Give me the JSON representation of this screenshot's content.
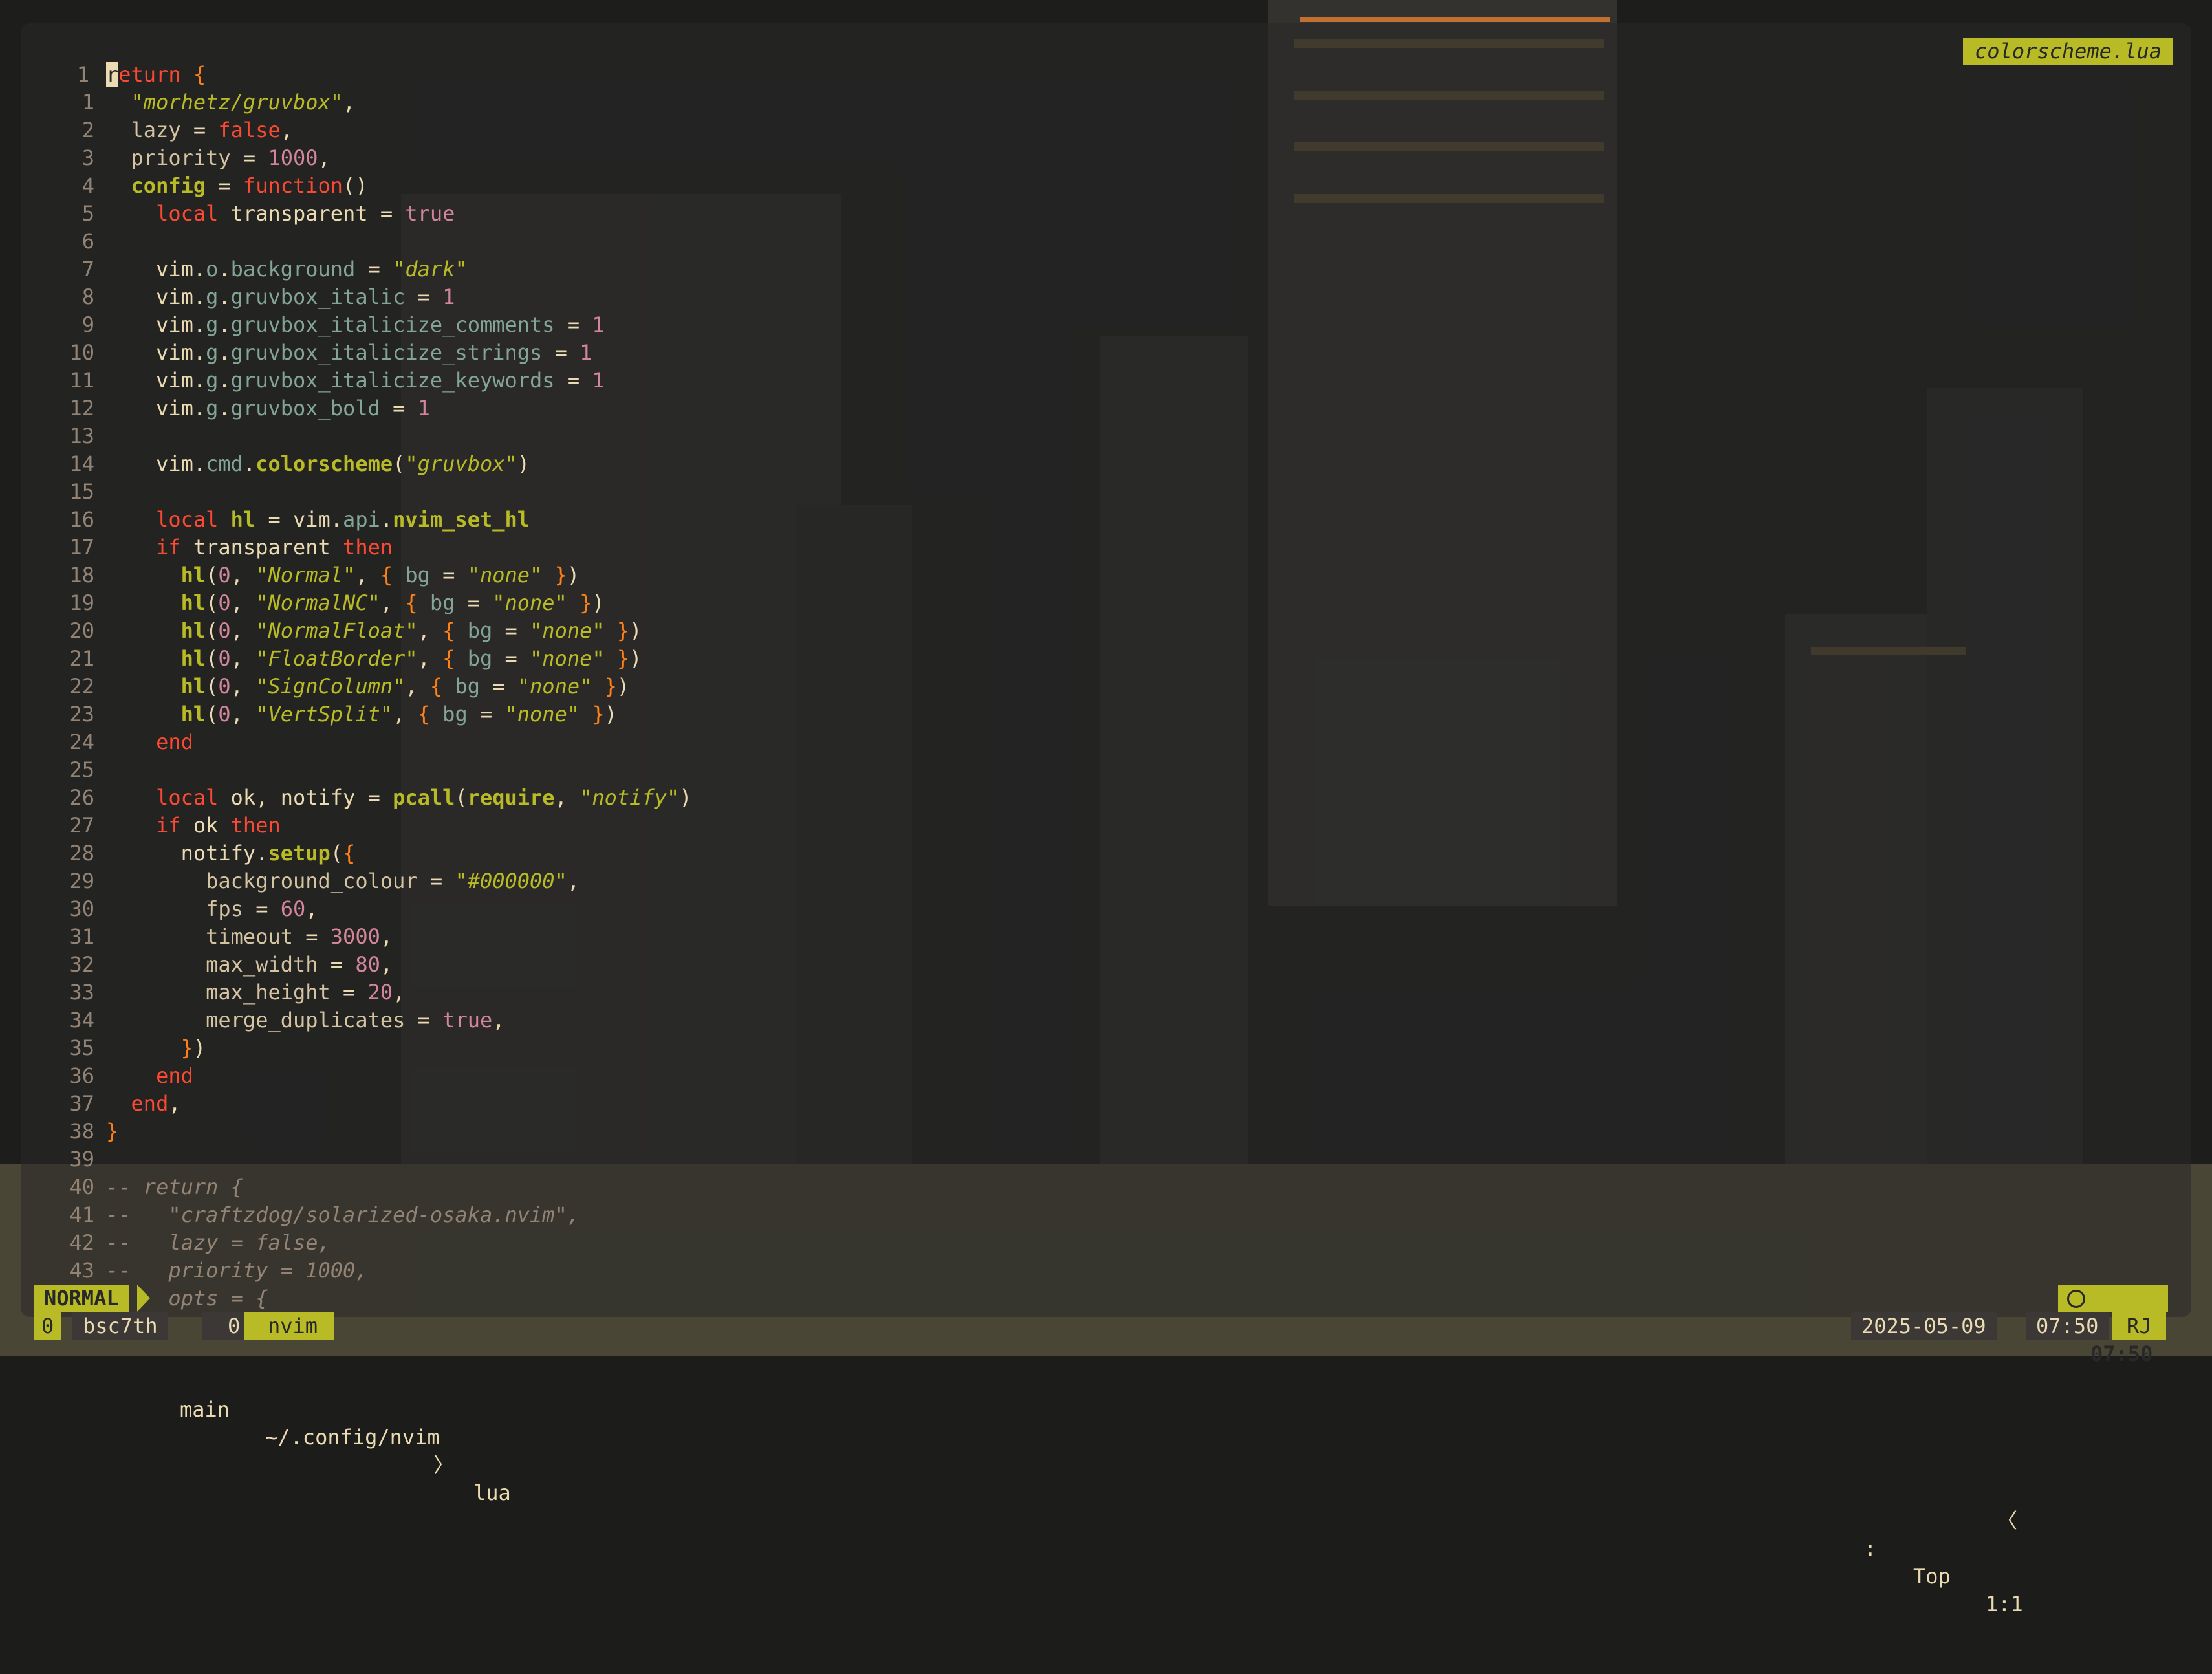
{
  "editor": {
    "filename_tag": "colorscheme.lua",
    "lines": [
      {
        "n": "1",
        "t": [
          [
            "cursor",
            "r"
          ],
          [
            "kw",
            "eturn"
          ],
          [
            "plain",
            " "
          ],
          [
            "brace",
            "{"
          ]
        ]
      },
      {
        "n": "1",
        "t": [
          [
            "plain",
            "  "
          ],
          [
            "str",
            "\"morhetz/gruvbox\""
          ],
          [
            "plain",
            ","
          ]
        ]
      },
      {
        "n": "2",
        "t": [
          [
            "field",
            "  lazy"
          ],
          [
            "plain",
            " = "
          ],
          [
            "kw",
            "false"
          ],
          [
            "plain",
            ","
          ]
        ]
      },
      {
        "n": "3",
        "t": [
          [
            "field",
            "  priority"
          ],
          [
            "plain",
            " = "
          ],
          [
            "num",
            "1000"
          ],
          [
            "plain",
            ","
          ]
        ]
      },
      {
        "n": "4",
        "t": [
          [
            "fn",
            "  config"
          ],
          [
            "plain",
            " = "
          ],
          [
            "kw",
            "function"
          ],
          [
            "plain",
            "()"
          ]
        ]
      },
      {
        "n": "5",
        "t": [
          [
            "plain",
            "    "
          ],
          [
            "kw",
            "local"
          ],
          [
            "plain",
            " transparent = "
          ],
          [
            "num",
            "true"
          ]
        ]
      },
      {
        "n": "6",
        "t": []
      },
      {
        "n": "7",
        "t": [
          [
            "plain",
            "    vim."
          ],
          [
            "prop",
            "o"
          ],
          [
            "plain",
            "."
          ],
          [
            "prop",
            "background"
          ],
          [
            "plain",
            " = "
          ],
          [
            "str",
            "\"dark\""
          ]
        ]
      },
      {
        "n": "8",
        "t": [
          [
            "plain",
            "    vim."
          ],
          [
            "prop",
            "g"
          ],
          [
            "plain",
            "."
          ],
          [
            "prop",
            "gruvbox_italic"
          ],
          [
            "plain",
            " = "
          ],
          [
            "num",
            "1"
          ]
        ]
      },
      {
        "n": "9",
        "t": [
          [
            "plain",
            "    vim."
          ],
          [
            "prop",
            "g"
          ],
          [
            "plain",
            "."
          ],
          [
            "prop",
            "gruvbox_italicize_comments"
          ],
          [
            "plain",
            " = "
          ],
          [
            "num",
            "1"
          ]
        ]
      },
      {
        "n": "10",
        "t": [
          [
            "plain",
            "    vim."
          ],
          [
            "prop",
            "g"
          ],
          [
            "plain",
            "."
          ],
          [
            "prop",
            "gruvbox_italicize_strings"
          ],
          [
            "plain",
            " = "
          ],
          [
            "num",
            "1"
          ]
        ]
      },
      {
        "n": "11",
        "t": [
          [
            "plain",
            "    vim."
          ],
          [
            "prop",
            "g"
          ],
          [
            "plain",
            "."
          ],
          [
            "prop",
            "gruvbox_italicize_keywords"
          ],
          [
            "plain",
            " = "
          ],
          [
            "num",
            "1"
          ]
        ]
      },
      {
        "n": "12",
        "t": [
          [
            "plain",
            "    vim."
          ],
          [
            "prop",
            "g"
          ],
          [
            "plain",
            "."
          ],
          [
            "prop",
            "gruvbox_bold"
          ],
          [
            "plain",
            " = "
          ],
          [
            "num",
            "1"
          ]
        ]
      },
      {
        "n": "13",
        "t": []
      },
      {
        "n": "14",
        "t": [
          [
            "plain",
            "    vim."
          ],
          [
            "prop",
            "cmd"
          ],
          [
            "plain",
            "."
          ],
          [
            "fn",
            "colorscheme"
          ],
          [
            "plain",
            "("
          ],
          [
            "str",
            "\"gruvbox\""
          ],
          [
            "plain",
            ")"
          ]
        ]
      },
      {
        "n": "15",
        "t": []
      },
      {
        "n": "16",
        "t": [
          [
            "plain",
            "    "
          ],
          [
            "kw",
            "local"
          ],
          [
            "plain",
            " "
          ],
          [
            "fn",
            "hl"
          ],
          [
            "plain",
            " = vim."
          ],
          [
            "prop",
            "api"
          ],
          [
            "plain",
            "."
          ],
          [
            "fn",
            "nvim_set_hl"
          ]
        ]
      },
      {
        "n": "17",
        "t": [
          [
            "plain",
            "    "
          ],
          [
            "kw",
            "if"
          ],
          [
            "plain",
            " transparent "
          ],
          [
            "kw",
            "then"
          ]
        ]
      },
      {
        "n": "18",
        "t": [
          [
            "plain",
            "      "
          ],
          [
            "fn",
            "hl"
          ],
          [
            "plain",
            "("
          ],
          [
            "num",
            "0"
          ],
          [
            "plain",
            ", "
          ],
          [
            "str",
            "\"Normal\""
          ],
          [
            "plain",
            ", "
          ],
          [
            "brace",
            "{"
          ],
          [
            "plain",
            " "
          ],
          [
            "prop",
            "bg"
          ],
          [
            "plain",
            " = "
          ],
          [
            "str",
            "\"none\""
          ],
          [
            "plain",
            " "
          ],
          [
            "brace",
            "}"
          ],
          [
            "plain",
            ")"
          ]
        ]
      },
      {
        "n": "19",
        "t": [
          [
            "plain",
            "      "
          ],
          [
            "fn",
            "hl"
          ],
          [
            "plain",
            "("
          ],
          [
            "num",
            "0"
          ],
          [
            "plain",
            ", "
          ],
          [
            "str",
            "\"NormalNC\""
          ],
          [
            "plain",
            ", "
          ],
          [
            "brace",
            "{"
          ],
          [
            "plain",
            " "
          ],
          [
            "prop",
            "bg"
          ],
          [
            "plain",
            " = "
          ],
          [
            "str",
            "\"none\""
          ],
          [
            "plain",
            " "
          ],
          [
            "brace",
            "}"
          ],
          [
            "plain",
            ")"
          ]
        ]
      },
      {
        "n": "20",
        "t": [
          [
            "plain",
            "      "
          ],
          [
            "fn",
            "hl"
          ],
          [
            "plain",
            "("
          ],
          [
            "num",
            "0"
          ],
          [
            "plain",
            ", "
          ],
          [
            "str",
            "\"NormalFloat\""
          ],
          [
            "plain",
            ", "
          ],
          [
            "brace",
            "{"
          ],
          [
            "plain",
            " "
          ],
          [
            "prop",
            "bg"
          ],
          [
            "plain",
            " = "
          ],
          [
            "str",
            "\"none\""
          ],
          [
            "plain",
            " "
          ],
          [
            "brace",
            "}"
          ],
          [
            "plain",
            ")"
          ]
        ]
      },
      {
        "n": "21",
        "t": [
          [
            "plain",
            "      "
          ],
          [
            "fn",
            "hl"
          ],
          [
            "plain",
            "("
          ],
          [
            "num",
            "0"
          ],
          [
            "plain",
            ", "
          ],
          [
            "str",
            "\"FloatBorder\""
          ],
          [
            "plain",
            ", "
          ],
          [
            "brace",
            "{"
          ],
          [
            "plain",
            " "
          ],
          [
            "prop",
            "bg"
          ],
          [
            "plain",
            " = "
          ],
          [
            "str",
            "\"none\""
          ],
          [
            "plain",
            " "
          ],
          [
            "brace",
            "}"
          ],
          [
            "plain",
            ")"
          ]
        ]
      },
      {
        "n": "22",
        "t": [
          [
            "plain",
            "      "
          ],
          [
            "fn",
            "hl"
          ],
          [
            "plain",
            "("
          ],
          [
            "num",
            "0"
          ],
          [
            "plain",
            ", "
          ],
          [
            "str",
            "\"SignColumn\""
          ],
          [
            "plain",
            ", "
          ],
          [
            "brace",
            "{"
          ],
          [
            "plain",
            " "
          ],
          [
            "prop",
            "bg"
          ],
          [
            "plain",
            " = "
          ],
          [
            "str",
            "\"none\""
          ],
          [
            "plain",
            " "
          ],
          [
            "brace",
            "}"
          ],
          [
            "plain",
            ")"
          ]
        ]
      },
      {
        "n": "23",
        "t": [
          [
            "plain",
            "      "
          ],
          [
            "fn",
            "hl"
          ],
          [
            "plain",
            "("
          ],
          [
            "num",
            "0"
          ],
          [
            "plain",
            ", "
          ],
          [
            "str",
            "\"VertSplit\""
          ],
          [
            "plain",
            ", "
          ],
          [
            "brace",
            "{"
          ],
          [
            "plain",
            " "
          ],
          [
            "prop",
            "bg"
          ],
          [
            "plain",
            " = "
          ],
          [
            "str",
            "\"none\""
          ],
          [
            "plain",
            " "
          ],
          [
            "brace",
            "}"
          ],
          [
            "plain",
            ")"
          ]
        ]
      },
      {
        "n": "24",
        "t": [
          [
            "plain",
            "    "
          ],
          [
            "kw",
            "end"
          ]
        ]
      },
      {
        "n": "25",
        "t": []
      },
      {
        "n": "26",
        "t": [
          [
            "plain",
            "    "
          ],
          [
            "kw",
            "local"
          ],
          [
            "plain",
            " ok, notify = "
          ],
          [
            "fn",
            "pcall"
          ],
          [
            "plain",
            "("
          ],
          [
            "fn",
            "require"
          ],
          [
            "plain",
            ", "
          ],
          [
            "str",
            "\"notify\""
          ],
          [
            "plain",
            ")"
          ]
        ]
      },
      {
        "n": "27",
        "t": [
          [
            "plain",
            "    "
          ],
          [
            "kw",
            "if"
          ],
          [
            "plain",
            " ok "
          ],
          [
            "kw",
            "then"
          ]
        ]
      },
      {
        "n": "28",
        "t": [
          [
            "plain",
            "      notify."
          ],
          [
            "fn",
            "setup"
          ],
          [
            "plain",
            "("
          ],
          [
            "brace",
            "{"
          ]
        ]
      },
      {
        "n": "29",
        "t": [
          [
            "field",
            "        background_colour"
          ],
          [
            "plain",
            " = "
          ],
          [
            "str",
            "\"#000000\""
          ],
          [
            "plain",
            ","
          ]
        ]
      },
      {
        "n": "30",
        "t": [
          [
            "field",
            "        fps"
          ],
          [
            "plain",
            " = "
          ],
          [
            "num",
            "60"
          ],
          [
            "plain",
            ","
          ]
        ]
      },
      {
        "n": "31",
        "t": [
          [
            "field",
            "        timeout"
          ],
          [
            "plain",
            " = "
          ],
          [
            "num",
            "3000"
          ],
          [
            "plain",
            ","
          ]
        ]
      },
      {
        "n": "32",
        "t": [
          [
            "field",
            "        max_width"
          ],
          [
            "plain",
            " = "
          ],
          [
            "num",
            "80"
          ],
          [
            "plain",
            ","
          ]
        ]
      },
      {
        "n": "33",
        "t": [
          [
            "field",
            "        max_height"
          ],
          [
            "plain",
            " = "
          ],
          [
            "num",
            "20"
          ],
          [
            "plain",
            ","
          ]
        ]
      },
      {
        "n": "34",
        "t": [
          [
            "field",
            "        merge_duplicates"
          ],
          [
            "plain",
            " = "
          ],
          [
            "num",
            "true"
          ],
          [
            "plain",
            ","
          ]
        ]
      },
      {
        "n": "35",
        "t": [
          [
            "plain",
            "      "
          ],
          [
            "brace",
            "}"
          ],
          [
            "plain",
            ")"
          ]
        ]
      },
      {
        "n": "36",
        "t": [
          [
            "plain",
            "    "
          ],
          [
            "kw",
            "end"
          ]
        ]
      },
      {
        "n": "37",
        "t": [
          [
            "plain",
            "  "
          ],
          [
            "kw",
            "end"
          ],
          [
            "plain",
            ","
          ]
        ]
      },
      {
        "n": "38",
        "t": [
          [
            "brace",
            "}"
          ]
        ]
      },
      {
        "n": "39",
        "t": []
      },
      {
        "n": "40",
        "t": [
          [
            "com",
            "-- return {"
          ]
        ]
      },
      {
        "n": "41",
        "t": [
          [
            "com",
            "--   \"craftzdog/solarized-osaka.nvim\","
          ]
        ]
      },
      {
        "n": "42",
        "t": [
          [
            "com",
            "--   lazy = false,"
          ]
        ]
      },
      {
        "n": "43",
        "t": [
          [
            "com",
            "--   priority = 1000,"
          ]
        ]
      },
      {
        "n": "44",
        "t": [
          [
            "com",
            "--   opts = {"
          ]
        ]
      }
    ]
  },
  "statusline": {
    "mode": "NORMAL",
    "branch_icon": "",
    "branch": "main",
    "path": "~/.config/nvim",
    "path_sep": "〉",
    "dir": "lua",
    "colon": ":",
    "position_word": "Top",
    "cursor_pos": "1:1",
    "clock": "07:50",
    "clock_icon": "clock-icon"
  },
  "tabline": {
    "count_left": "0",
    "session": "bsc7th",
    "window_index": "0",
    "window_name": "nvim",
    "date": "2025-05-09",
    "sep": "〈",
    "time": "07:50",
    "user": "RJ"
  },
  "colors": {
    "accent_yellow": "#b8bb26",
    "accent_dark": "#3c3836",
    "fg": "#ebdbb2",
    "keyword": "#fb4934",
    "string": "#b8bb26",
    "number": "#d3869b",
    "comment": "#928374"
  }
}
